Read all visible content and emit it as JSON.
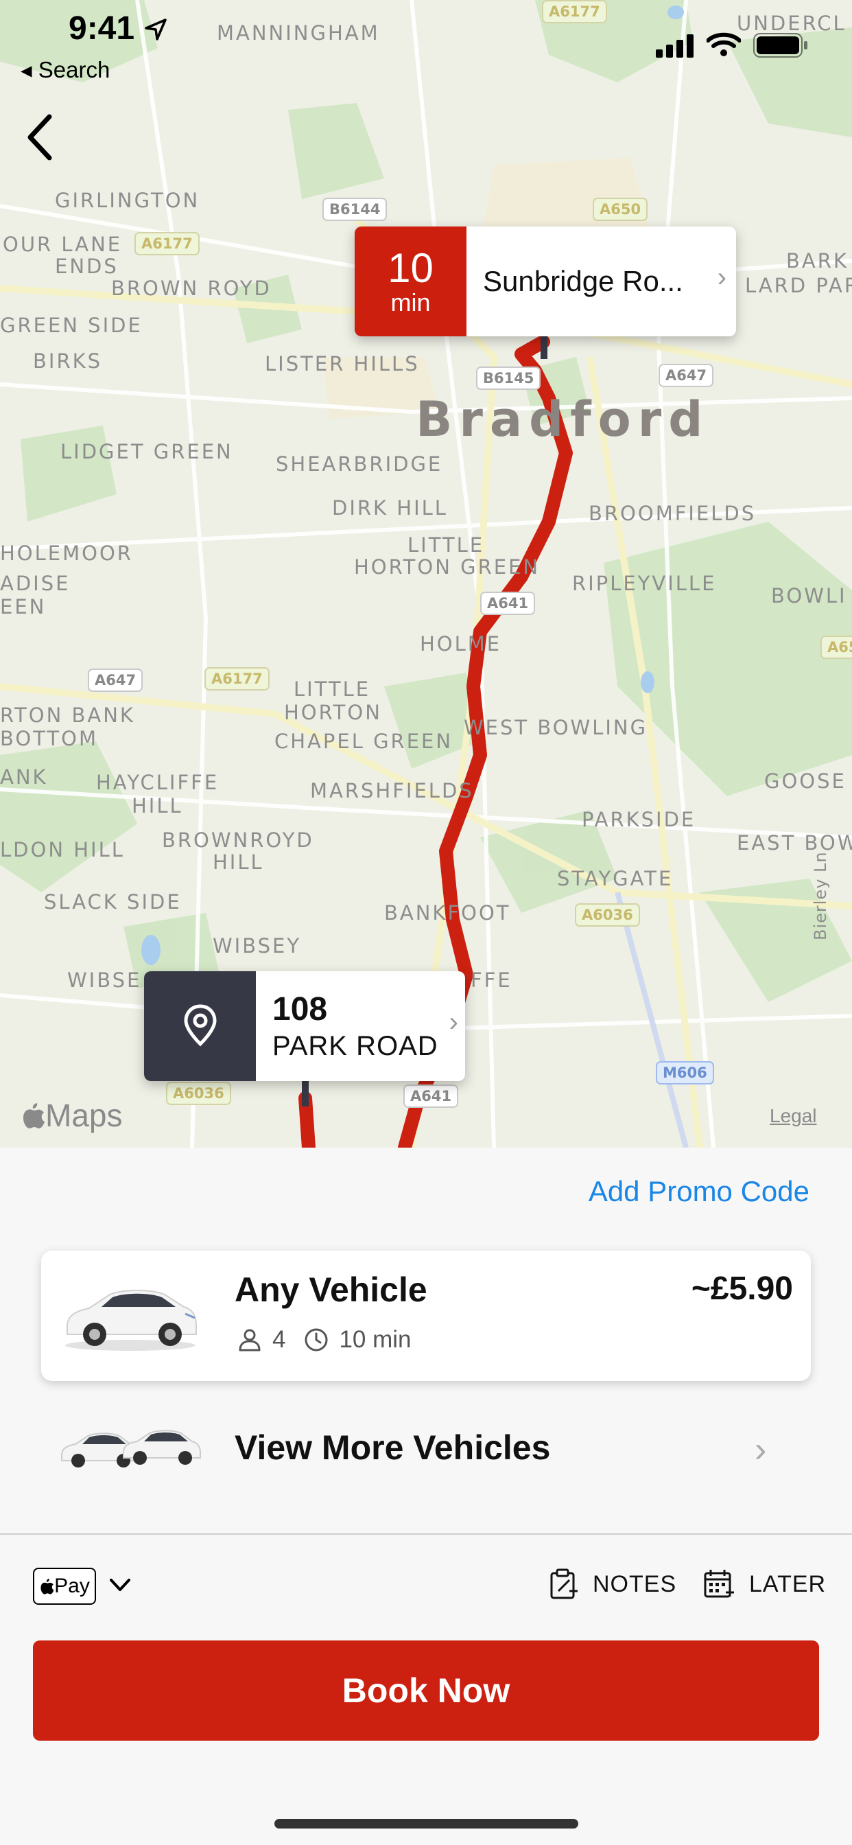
{
  "status_bar": {
    "time": "9:41",
    "back_label": "◂ Search"
  },
  "map": {
    "city": "Bradford",
    "places": [
      "MANNINGHAM",
      "GIRLINGTON",
      "OUR LANE",
      "ENDS",
      "BROWN ROYD",
      "GREEN SIDE",
      "BIRKS",
      "LISTER HILLS",
      "LIDGET GREEN",
      "SHEARBRIDGE",
      "DIRK HILL",
      "LITTLE",
      "HORTON GREEN",
      "BROOMFIELDS",
      "RIPLEYVILLE",
      "HOLEMOOR",
      "ADISE",
      "EEN",
      "HOLME",
      "BOWLI",
      "RTON BANK",
      "BOTTOM",
      "LITTLE",
      "HORTON",
      "CHAPEL GREEN",
      "WEST BOWLING",
      "GOOSE",
      "ANK",
      "HAYCLIFFE",
      "HILL",
      "MARSHFIELDS",
      "PARKSIDE",
      "LDON HILL",
      "BROWNROYD",
      "HILL",
      "EAST BOW",
      "STAYGATE",
      "SLACK SIDE",
      "BANKFOOT",
      "WIBSEY",
      "WIBSE",
      "FFE",
      "UNDERCL",
      "BARK",
      "LARD PAR",
      "Bierley Ln"
    ],
    "shields": [
      "A6177",
      "B6144",
      "A650",
      "A6177",
      "A647",
      "B6145",
      "A641",
      "A647",
      "A6177",
      "A65",
      "A6036",
      "A6036",
      "A641",
      "M606"
    ],
    "maps_logo": "Maps",
    "legal": "Legal"
  },
  "destination_callout": {
    "minutes": "10",
    "unit": "min",
    "name": "Sunbridge Ro..."
  },
  "pickup_callout": {
    "line1": "108",
    "line2": "PARK ROAD"
  },
  "sheet": {
    "promo": "Add Promo Code",
    "vehicle": {
      "name": "Any Vehicle",
      "price": "~£5.90",
      "seats": "4",
      "eta": "10 min"
    },
    "more_vehicles": "View More Vehicles",
    "payment": "Pay",
    "notes": "NOTES",
    "later": "LATER",
    "book": "Book Now"
  }
}
